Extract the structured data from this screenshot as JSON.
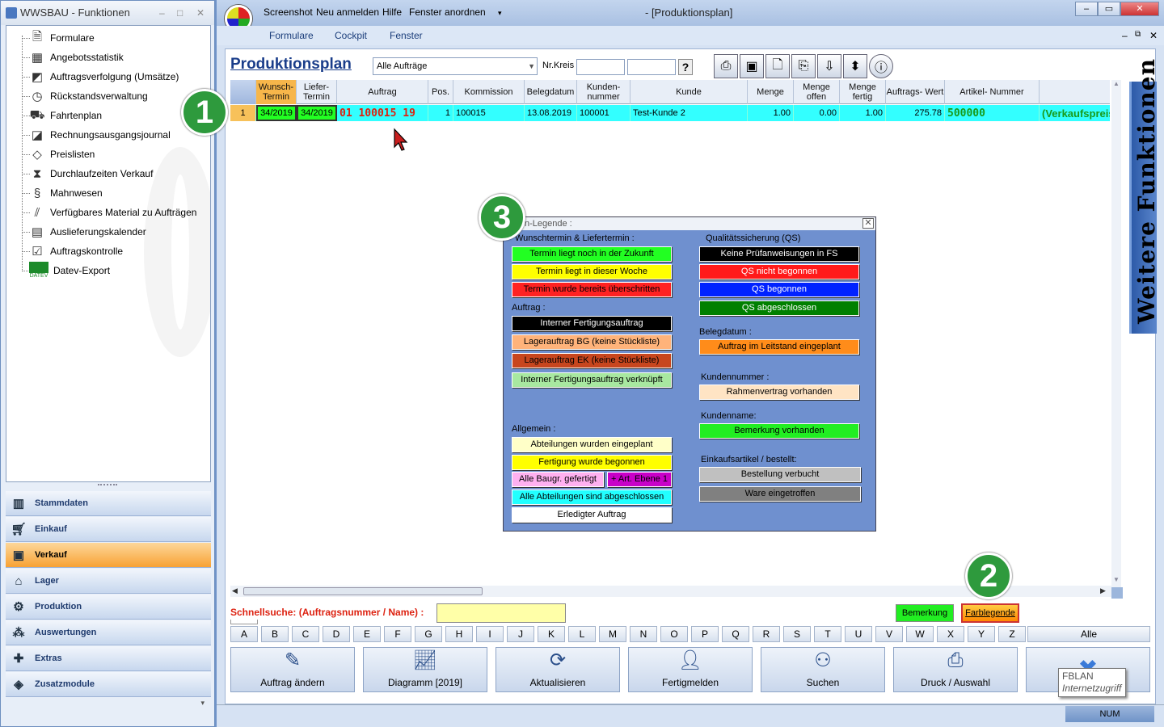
{
  "left_window": {
    "title": "WWSBAU - Funktionen",
    "controls": [
      "–",
      "□",
      "✕"
    ],
    "tree_items": [
      {
        "label": "Formulare",
        "icon": "document-icon"
      },
      {
        "label": "Angebotsstatistik",
        "icon": "calendar-stats-icon"
      },
      {
        "label": "Auftragsverfolgung (Umsätze)",
        "icon": "tracking-icon"
      },
      {
        "label": "Rückstandsverwaltung",
        "icon": "clock-icon"
      },
      {
        "label": "Fahrtenplan",
        "icon": "truck-icon"
      },
      {
        "label": "Rechnungsausgangsjournal",
        "icon": "journal-icon"
      },
      {
        "label": "Preislisten",
        "icon": "price-tag-icon"
      },
      {
        "label": "Durchlaufzeiten Verkauf",
        "icon": "hourglass-icon"
      },
      {
        "label": "Mahnwesen",
        "icon": "dunning-icon"
      },
      {
        "label": "Verfügbares Material zu Aufträgen",
        "icon": "material-icon"
      },
      {
        "label": "Auslieferungskalender",
        "icon": "calendar-icon"
      },
      {
        "label": "Auftragskontrolle",
        "icon": "clipboard-check-icon"
      },
      {
        "label": "Datev-Export",
        "icon": "datev-icon"
      }
    ],
    "datev_logo_text": "DATEV",
    "nav_buttons": [
      {
        "label": "Stammdaten",
        "icon": "master-data-icon",
        "active": false
      },
      {
        "label": "Einkauf",
        "icon": "cart-icon",
        "active": false
      },
      {
        "label": "Verkauf",
        "icon": "cash-register-icon",
        "active": true
      },
      {
        "label": "Lager",
        "icon": "warehouse-icon",
        "active": false
      },
      {
        "label": "Produktion",
        "icon": "production-icon",
        "active": false
      },
      {
        "label": "Auswertungen",
        "icon": "analytics-icon",
        "active": false
      },
      {
        "label": "Extras",
        "icon": "extras-icon",
        "active": false
      },
      {
        "label": "Zusatzmodule",
        "icon": "modules-icon",
        "active": false
      }
    ]
  },
  "main_window": {
    "quick_access": [
      "Screenshot",
      "Neu anmelden",
      "Hilfe",
      "Fenster anordnen"
    ],
    "title": "- [Produktionsplan]",
    "menu": [
      "Formulare",
      "Cockpit",
      "Fenster"
    ],
    "page_title": "Produktionsplan",
    "filter_value": "Alle Aufträge",
    "nrkreis_label": "Nr.Kreis",
    "help_label": "?",
    "toolbar_icons": [
      "printer-icon",
      "screen-icon",
      "info-doc-icon",
      "copy-icon",
      "sort-down-icon",
      "expand-icon",
      "info-icon"
    ],
    "grid": {
      "headers": [
        "",
        "Wunsch-\nTermin",
        "Liefer-\nTermin",
        "Auftrag",
        "Pos.",
        "Kommission",
        "Belegdatum",
        "Kunden-\nnummer",
        "Kunde",
        "Menge",
        "Menge\noffen",
        "Menge\nfertig",
        "Auftrags- Wert",
        "Artikel- Nummer",
        ""
      ],
      "rows": [
        [
          "1",
          "34/2019",
          "34/2019",
          "01 100015 19",
          "1",
          "100015",
          "13.08.2019",
          "100001",
          "Test-Kunde 2",
          "1.00",
          "0.00",
          "1.00",
          "275.78",
          "500000",
          "(Verkaufspreis"
        ]
      ]
    },
    "side_tab": "Weitere Funktionen",
    "quicksearch_label": "Schnellsuche: (Auftragsnummer / Name) :",
    "quicksearch_value": "",
    "bemerkung_label": "Bemerkung",
    "farblegende_label": "Farblegende",
    "letters": [
      "A",
      "B",
      "C",
      "D",
      "E",
      "F",
      "G",
      "H",
      "I",
      "J",
      "K",
      "L",
      "M",
      "N",
      "O",
      "P",
      "Q",
      "R",
      "S",
      "T",
      "U",
      "V",
      "W",
      "X",
      "Y",
      "Z"
    ],
    "alle_label": "Alle",
    "bottom_buttons": [
      {
        "label": "Auftrag ändern",
        "icon": "edit-icon"
      },
      {
        "label": "Diagramm [2019]",
        "icon": "chart-icon"
      },
      {
        "label": "Aktualisieren",
        "icon": "refresh-icon"
      },
      {
        "label": "Fertigmelden",
        "icon": "user-check-icon"
      },
      {
        "label": "Suchen",
        "icon": "binoculars-icon"
      },
      {
        "label": "Druck / Auswahl",
        "icon": "printer-icon"
      },
      {
        "label": "",
        "icon": "close-x-icon"
      }
    ],
    "tooltip_line1": "FBLAN",
    "tooltip_line2": "Internetzugriff",
    "status_num": "NUM"
  },
  "legend": {
    "title": "n-Legende :",
    "sections": {
      "termin_header": "Wunschtermin & Liefertermin :",
      "termin": [
        {
          "label": "Termin liegt noch in der Zukunft",
          "bg": "#22ff22",
          "fg": "#000000"
        },
        {
          "label": "Termin liegt in dieser Woche",
          "bg": "#ffff00",
          "fg": "#000000"
        },
        {
          "label": "Termin wurde bereits überschritten",
          "bg": "#ff2222",
          "fg": "#000000"
        }
      ],
      "auftrag_header": "Auftrag :",
      "auftrag": [
        {
          "label": "Interner Fertigungsauftrag",
          "bg": "#000000",
          "fg": "#ffffff"
        },
        {
          "label": "Lagerauftrag BG (keine Stückliste)",
          "bg": "#ffb37a",
          "fg": "#000000"
        },
        {
          "label": "Lagerauftrag EK (keine Stückliste)",
          "bg": "#c8461e",
          "fg": "#000000"
        },
        {
          "label": "Interner Fertigungsauftrag verknüpft",
          "bg": "#a8e8a0",
          "fg": "#000000"
        }
      ],
      "allgemein_header": "Allgemein :",
      "allgemein": [
        {
          "label": "Abteilungen wurden eingeplant",
          "bg": "#ffffc8",
          "fg": "#000000"
        },
        {
          "label": "Fertigung wurde begonnen",
          "bg": "#ffff00",
          "fg": "#000000"
        },
        {
          "label": "Alle Baugr. gefertigt",
          "bg": "#ffb0f0",
          "fg": "#000000"
        },
        {
          "label": "+ Art. Ebene 1",
          "bg": "#c800c8",
          "fg": "#000000"
        },
        {
          "label": "Alle Abteilungen sind abgeschlossen",
          "bg": "#22ffff",
          "fg": "#000000"
        },
        {
          "label": "Erledigter Auftrag",
          "bg": "#ffffff",
          "fg": "#000000"
        }
      ],
      "qs_header": "Qualitätssicherung (QS)",
      "qs": [
        {
          "label": "Keine Prüfanweisungen in FS",
          "bg": "#000000",
          "fg": "#ffffff"
        },
        {
          "label": "QS nicht begonnen",
          "bg": "#ff1a1a",
          "fg": "#ffffff"
        },
        {
          "label": "QS begonnen",
          "bg": "#0022ff",
          "fg": "#ffffff"
        },
        {
          "label": "QS abgeschlossen",
          "bg": "#008000",
          "fg": "#ffffff"
        }
      ],
      "beleg_header": "Belegdatum :",
      "beleg": [
        {
          "label": "Auftrag im Leitstand eingeplant",
          "bg": "#ff8c1a",
          "fg": "#000000"
        }
      ],
      "kundennr_header": "Kundennummer :",
      "kundennr": [
        {
          "label": "Rahmenvertrag vorhanden",
          "bg": "#ffe4c4",
          "fg": "#000000"
        }
      ],
      "kundenname_header": "Kundenname:",
      "kundenname": [
        {
          "label": "Bemerkung vorhanden",
          "bg": "#22ee22",
          "fg": "#000000"
        }
      ],
      "einkauf_header": "Einkaufsartikel / bestellt:",
      "einkauf": [
        {
          "label": "Bestellung verbucht",
          "bg": "#c0c0c0",
          "fg": "#000000"
        },
        {
          "label": "Ware eingetroffen",
          "bg": "#808080",
          "fg": "#000000"
        }
      ]
    }
  },
  "callouts": [
    "1",
    "2",
    "3"
  ]
}
